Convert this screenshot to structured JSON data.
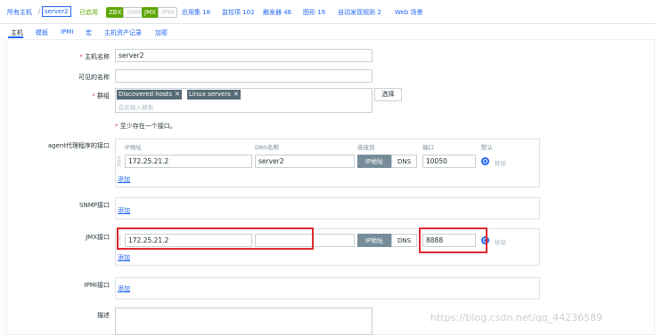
{
  "breadcrumb": {
    "all_hosts": "所有主机",
    "separator": "/",
    "current": "server2",
    "enabled": "已启用",
    "tags": [
      "ZBX",
      "SNMP",
      "JMX",
      "IPMI"
    ],
    "applications": "应用集 18",
    "items": "监控项 102",
    "triggers": "触发器 46",
    "graphs": "图形 19",
    "discovery": "自动发现规则 2",
    "web": "Web 场景"
  },
  "tabs": [
    "主机",
    "模板",
    "IPMI",
    "宏",
    "主机资产记录",
    "加密"
  ],
  "form": {
    "host_name_label": "主机名称",
    "host_name_value": "server2",
    "visible_name_label": "可见的名称",
    "visible_name_value": "",
    "groups_label": "群组",
    "groups": [
      "Discovered hosts",
      "Linux servers"
    ],
    "groups_placeholder": "在此输入搜索",
    "select_button": "选择",
    "interface_note": "至少存在一个接口。",
    "agent_label": "agent代理程序的接口",
    "col_ip": "IP地址",
    "col_dns": "DNS名称",
    "col_connect": "连接到",
    "col_port": "端口",
    "col_default": "默认",
    "agent_ip": "172.25.21.2",
    "agent_dns": "server2",
    "agent_port": "10050",
    "ip_option": "IP地址",
    "dns_option": "DNS",
    "remove_link": "移除",
    "add_link": "添加",
    "snmp_label": "SNMP接口",
    "jmx_label": "JMX接口",
    "jmx_ip": "172.25.21.2",
    "jmx_dns": "",
    "jmx_port": "8888",
    "ipmi_label": "IPMI接口",
    "description_label": "描述"
  },
  "watermark": "https://blog.csdn.net/qq_44236589",
  "colors": {
    "link": "#1f65f4",
    "tag_green": "#5ca700",
    "highlight": "#e0282f"
  }
}
